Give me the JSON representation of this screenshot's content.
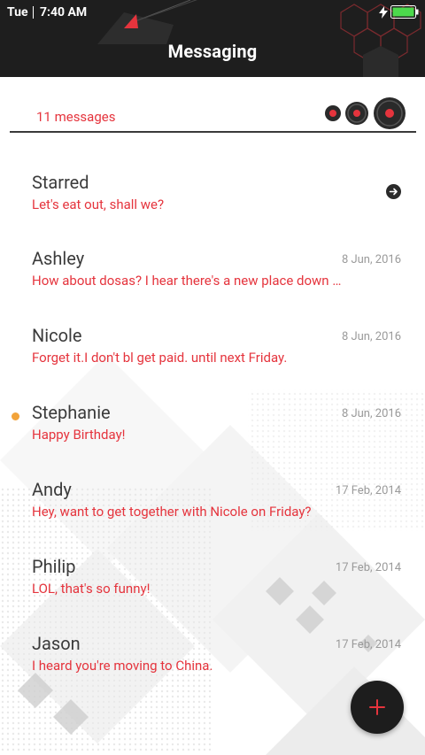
{
  "status_bar": {
    "day": "Tue",
    "time": "7:40 AM"
  },
  "header": {
    "title": "Messaging"
  },
  "count_bar": {
    "count_label": "11 messages"
  },
  "messages": [
    {
      "name": "Starred",
      "preview": "Let's eat out, shall we?",
      "date": "",
      "unread": false,
      "has_arrow": true
    },
    {
      "name": "Ashley",
      "preview": "How about dosas? I hear there's a new place down the street",
      "date": "8 Jun, 2016",
      "unread": false
    },
    {
      "name": "Nicole",
      "preview": "Forget it.I don't bl get paid. until next Friday.",
      "date": "8 Jun, 2016",
      "unread": false
    },
    {
      "name": "Stephanie",
      "preview": "Happy Birthday!",
      "date": "8 Jun, 2016",
      "unread": true
    },
    {
      "name": "Andy",
      "preview": "Hey, want to get together with Nicole on Friday?",
      "date": "17 Feb, 2014",
      "unread": false
    },
    {
      "name": "Philip",
      "preview": "LOL, that's so funny!",
      "date": "17 Feb, 2014",
      "unread": false
    },
    {
      "name": "Jason",
      "preview": "I heard you're moving to China.",
      "date": "17 Feb, 2014",
      "unread": false
    }
  ],
  "fab": {
    "icon": "plus-icon"
  },
  "colors": {
    "accent": "#e5343d",
    "header_bg": "#1e1e1e",
    "unread": "#f2a33a",
    "name": "#3b3b3b",
    "date": "#9a9a9a"
  }
}
